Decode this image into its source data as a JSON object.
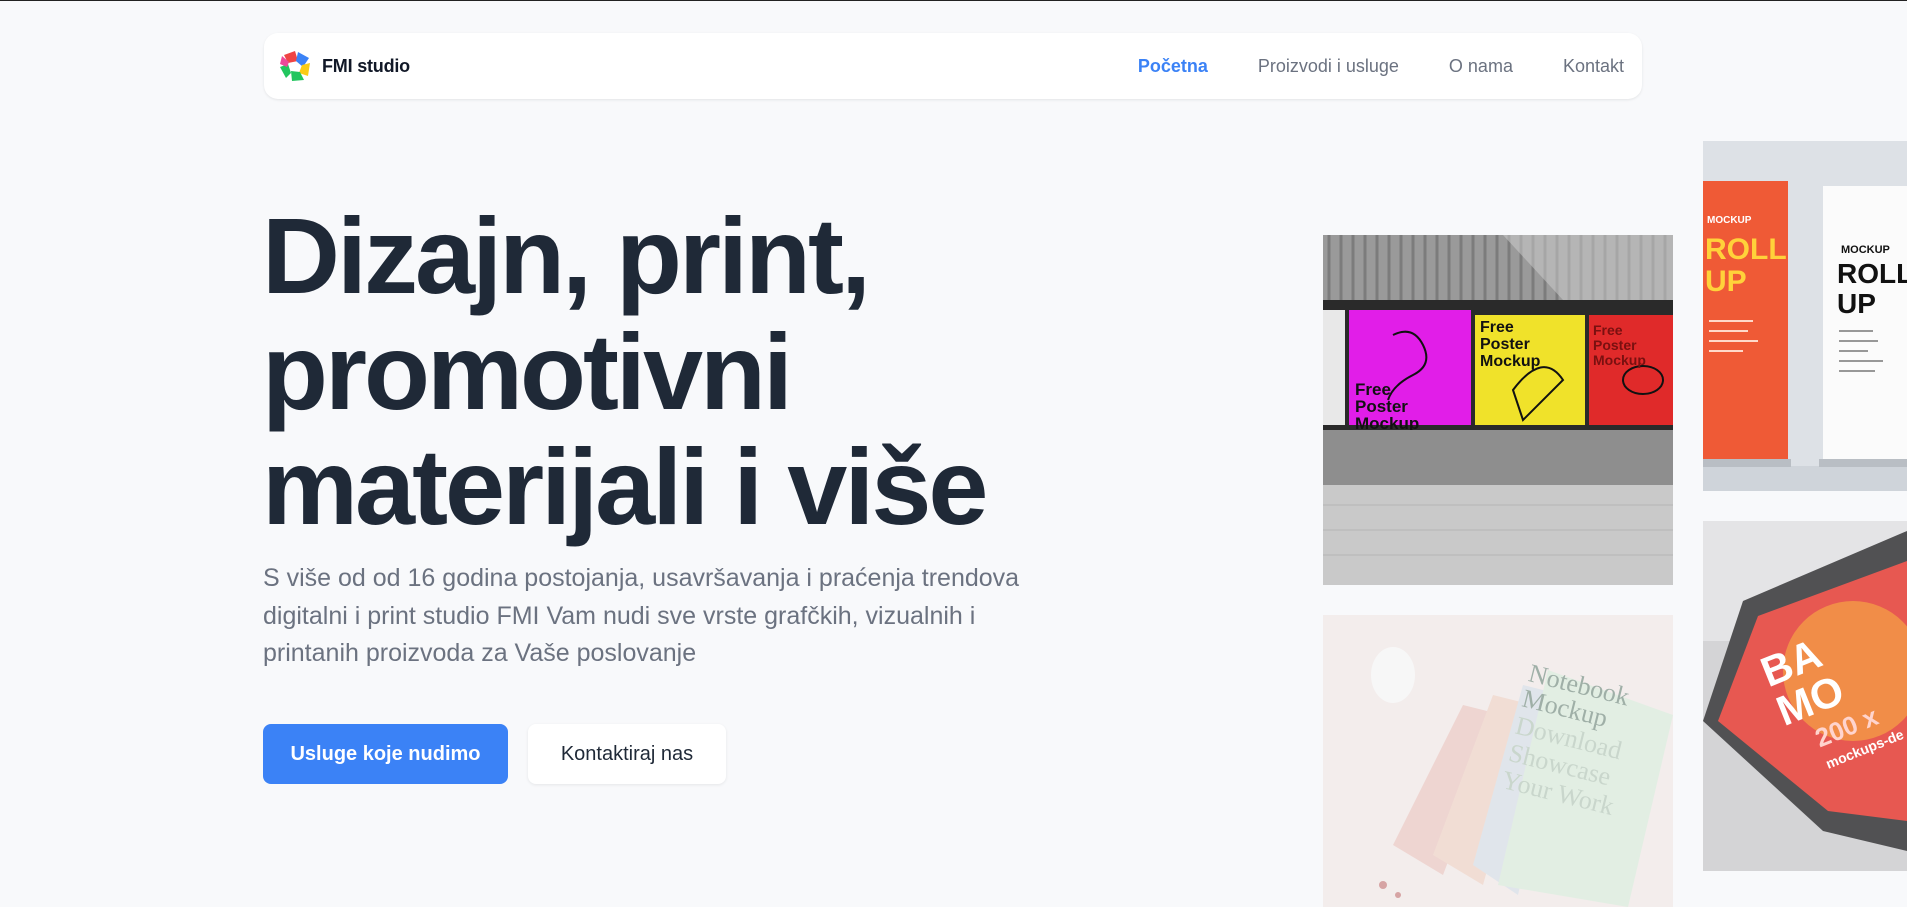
{
  "brand": {
    "name": "FMI studio",
    "logo_icon": "fmi-logo-icon"
  },
  "nav": {
    "links": [
      {
        "label": "Početna",
        "active": true
      },
      {
        "label": "Proizvodi i usluge",
        "active": false
      },
      {
        "label": "O nama",
        "active": false
      },
      {
        "label": "Kontakt",
        "active": false
      }
    ]
  },
  "hero": {
    "title_lines": [
      "Dizajn, print,",
      "promotivni",
      "materijali i više"
    ],
    "subtitle": "S više od od 16 godina postojanja, usavršavanja i praćenja trendova digitalni i print studio FMI Vam nudi sve vrste grafčkih, vizualnih i printanih proizvoda za Vaše poslovanje",
    "primary_button": "Usluge koje nudimo",
    "secondary_button": "Kontaktiraj nas"
  },
  "gallery": {
    "poster_mockup": {
      "poster_left": [
        "Free",
        "Poster",
        "Mockup"
      ],
      "poster_middle": [
        "Free",
        "Poster",
        "Mockup"
      ],
      "poster_right": [
        "Free",
        "Poster",
        "Mockup"
      ]
    },
    "rollup_mockup": {
      "left_top": "MOCKUP",
      "left_big": [
        "ROLL",
        "UP"
      ],
      "right_top": "MOCKUP",
      "right_big": [
        "ROLL",
        "UP"
      ]
    },
    "notebook_mockup": {
      "lines": [
        "Notebook",
        "Mockup",
        "Download",
        "Showcase",
        "Your Work"
      ]
    },
    "banner_mockup": {
      "lines": [
        "BA",
        "MO",
        "200 x",
        "mockups-de"
      ]
    }
  },
  "colors": {
    "accent": "#3b82f6",
    "heading": "#1f2937",
    "muted": "#6b7280",
    "background": "#f8f9fb"
  }
}
